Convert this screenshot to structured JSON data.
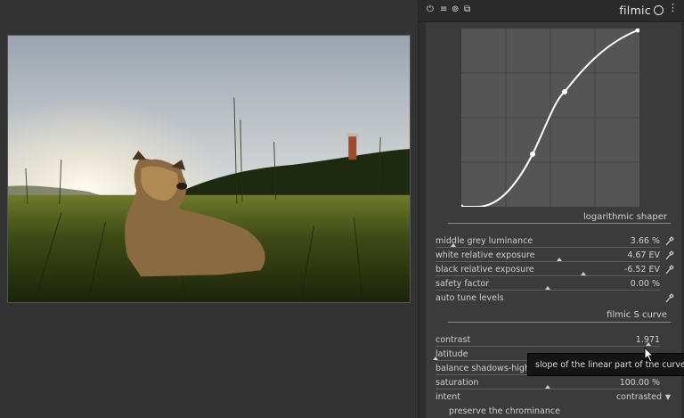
{
  "module": {
    "name": "filmic",
    "header_icons": [
      "power-icon",
      "presets-menu-icon",
      "multi-instance-icon",
      "reset-icon"
    ]
  },
  "sections": {
    "log_shaper": "logarithmic shaper",
    "s_curve": "filmic S curve"
  },
  "sliders": [
    {
      "id": "middle-grey-luminance",
      "label": "middle grey luminance",
      "value": "3.66 %",
      "position": 0.08,
      "picker": true
    },
    {
      "id": "white-relative-exposure",
      "label": "white relative exposure",
      "value": "4.67 EV",
      "position": 0.55,
      "picker": true
    },
    {
      "id": "black-relative-exposure",
      "label": "black relative exposure",
      "value": "-6.52 EV",
      "position": 0.66,
      "picker": true
    },
    {
      "id": "safety-factor",
      "label": "safety factor",
      "value": "0.00 %",
      "position": 0.5,
      "picker": false
    }
  ],
  "auto_tune": {
    "label": "auto tune levels"
  },
  "curve_sliders": [
    {
      "id": "contrast",
      "label": "contrast",
      "value": "1.971",
      "position": 0.95
    },
    {
      "id": "latitude",
      "label": "latitude",
      "value": "",
      "position": 0.0
    },
    {
      "id": "balance-shadows-highlights",
      "label": "balance shadows-highl",
      "value": "",
      "position": 0.5
    },
    {
      "id": "saturation",
      "label": "saturation",
      "value": "100.00 %",
      "position": 0.5
    }
  ],
  "intent": {
    "label": "intent",
    "value": "contrasted"
  },
  "preserve_chrominance": {
    "label": "preserve the chrominance"
  },
  "tooltip": "slope of the linear part of the curve"
}
